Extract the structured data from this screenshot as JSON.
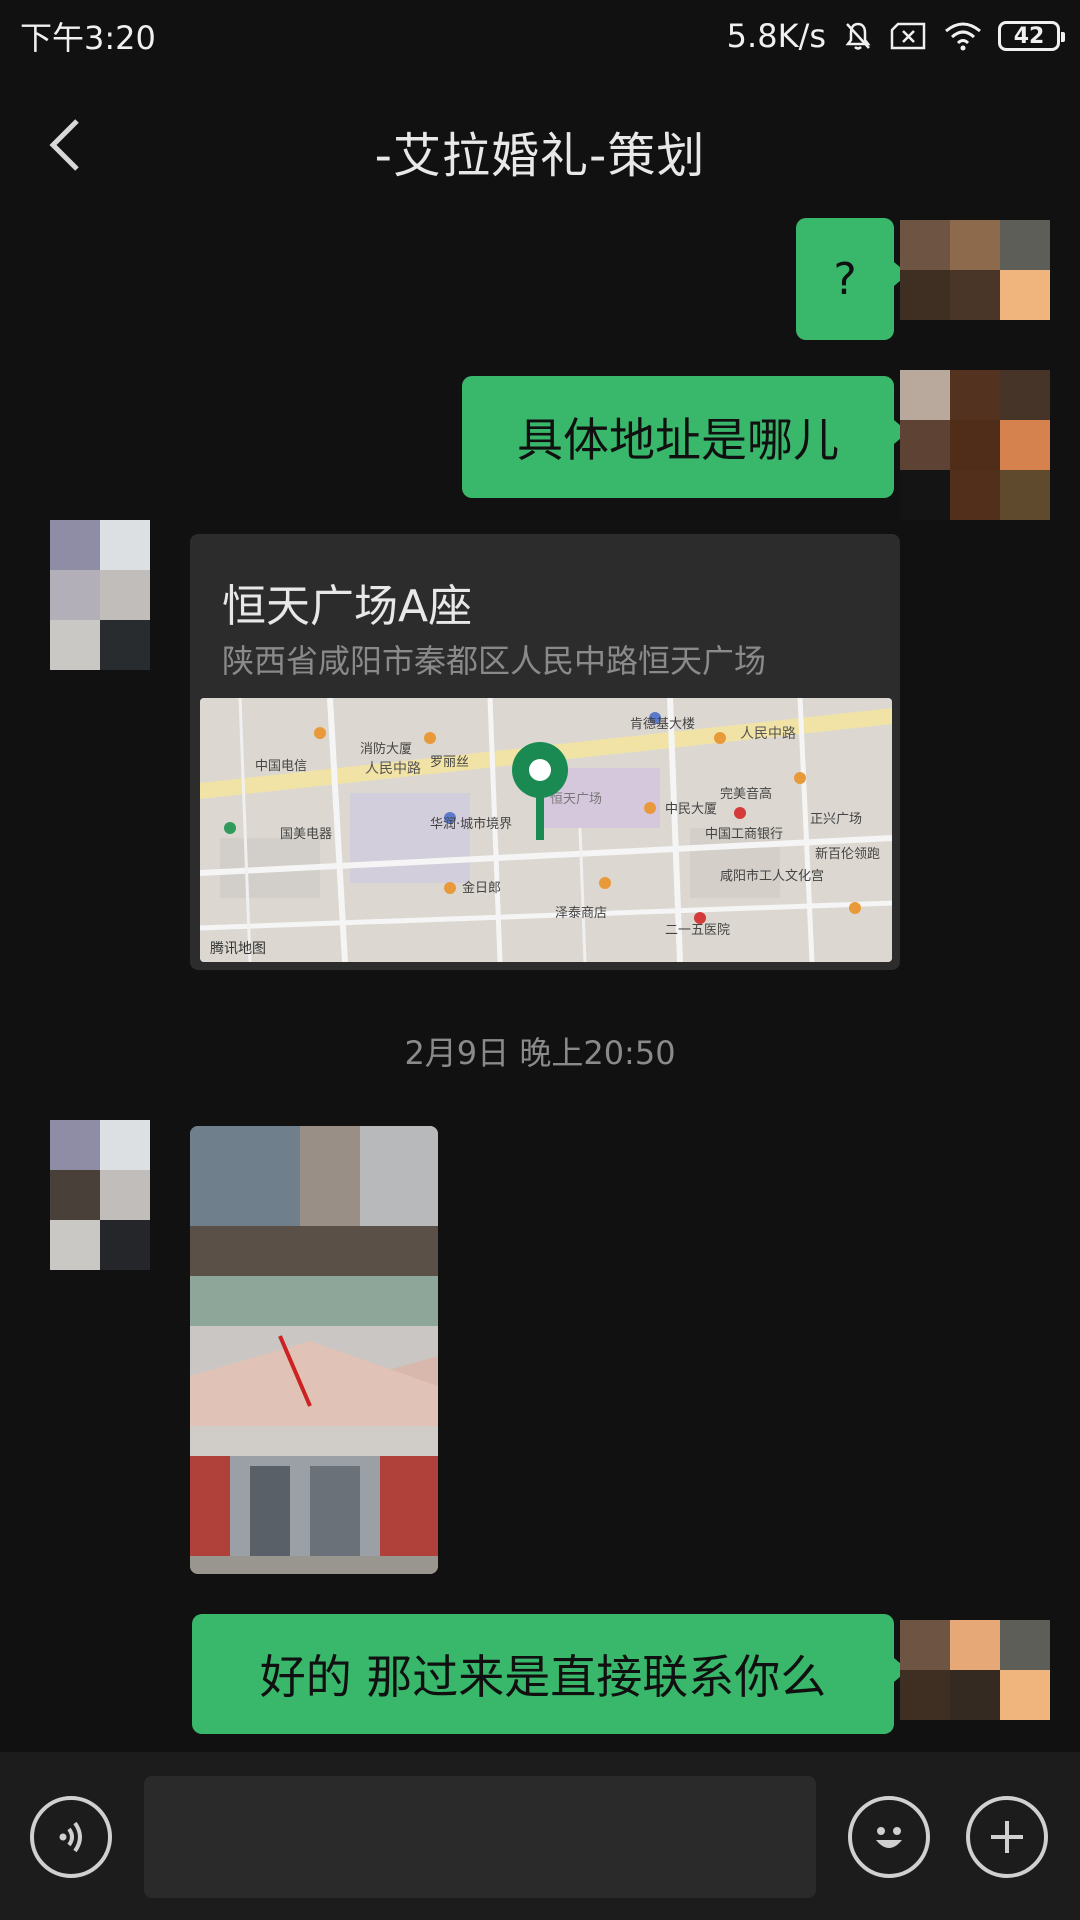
{
  "status_bar": {
    "time": "下午3:20",
    "net_speed": "5.8K/s",
    "battery": "42"
  },
  "header": {
    "title": "-艾拉婚礼-策划",
    "back_icon": "chevron-left-icon"
  },
  "messages": [
    {
      "sender": "me",
      "type": "text",
      "text": "?"
    },
    {
      "sender": "me",
      "type": "text",
      "text": "具体地址是哪儿"
    },
    {
      "sender": "other",
      "type": "location",
      "name": "恒天广场A座",
      "address": "陕西省咸阳市秦都区人民中路恒天广场",
      "map_labels": [
        "人民中路",
        "中国电信",
        "恒天广场",
        "中国工商银行",
        "咸阳市工人文化宫",
        "国美电器",
        "消防大厦",
        "罗丽丝",
        "肯德基大楼",
        "中民大厦",
        "完美音高",
        "正兴广场",
        "新百伦领跑",
        "金日郎",
        "华润·城市境界",
        "泽泰商店",
        "二一五医院",
        "腾讯地图"
      ]
    },
    {
      "type": "timestamp",
      "text": "2月9日 晚上20:50"
    },
    {
      "sender": "other",
      "type": "image"
    },
    {
      "sender": "me",
      "type": "text",
      "text": "好的 那过来是直接联系你么"
    }
  ],
  "input_bar": {
    "placeholder": "",
    "voice_icon": "voice-icon",
    "emoji_icon": "emoji-icon",
    "plus_icon": "plus-icon"
  },
  "colors": {
    "background": "#111111",
    "bubble_me": "#39b86c",
    "location_pin": "#1a8a52"
  }
}
